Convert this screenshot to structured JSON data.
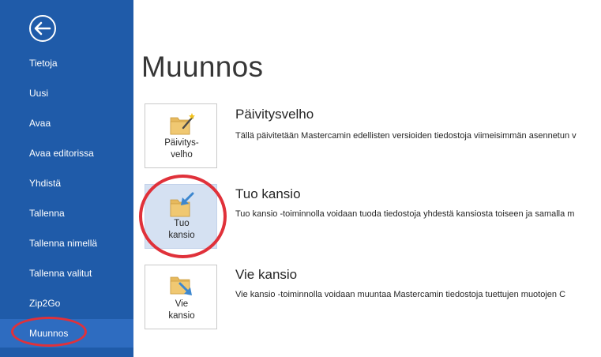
{
  "sidebar": {
    "back_icon": "back-arrow-icon",
    "items": [
      {
        "label": "Tietoja"
      },
      {
        "label": "Uusi"
      },
      {
        "label": "Avaa"
      },
      {
        "label": "Avaa editorissa"
      },
      {
        "label": "Yhdistä"
      },
      {
        "label": "Tallenna"
      },
      {
        "label": "Tallenna nimellä"
      },
      {
        "label": "Tallenna valitut"
      },
      {
        "label": "Zip2Go"
      },
      {
        "label": "Muunnos"
      }
    ],
    "active_item": "Muunnos"
  },
  "main": {
    "title": "Muunnos",
    "options": [
      {
        "tile_label": "Päivitys-\nvelho",
        "title": "Päivitysvelho",
        "description": "Tällä päivitetään Mastercamin edellisten versioiden tiedostoja viimeisimmän asennetun v",
        "icon": "folder-wand-icon"
      },
      {
        "tile_label": "Tuo\nkansio",
        "title": "Tuo kansio",
        "description": "Tuo kansio -toiminnolla voidaan tuoda tiedostoja yhdestä kansiosta toiseen ja samalla m",
        "icon": "folder-import-icon"
      },
      {
        "tile_label": "Vie\nkansio",
        "title": "Vie kansio",
        "description": "Vie kansio -toiminnolla voidaan muuntaa Mastercamin tiedostoja tuettujen muotojen C",
        "icon": "folder-export-icon"
      }
    ]
  },
  "colors": {
    "sidebar_bg": "#1f5ba9",
    "sidebar_active": "#2e6cc0",
    "highlight_ring": "#e0313a",
    "tile_selected": "#d5e1f2",
    "folder": "#e7b95d",
    "arrow": "#3d87cf"
  }
}
